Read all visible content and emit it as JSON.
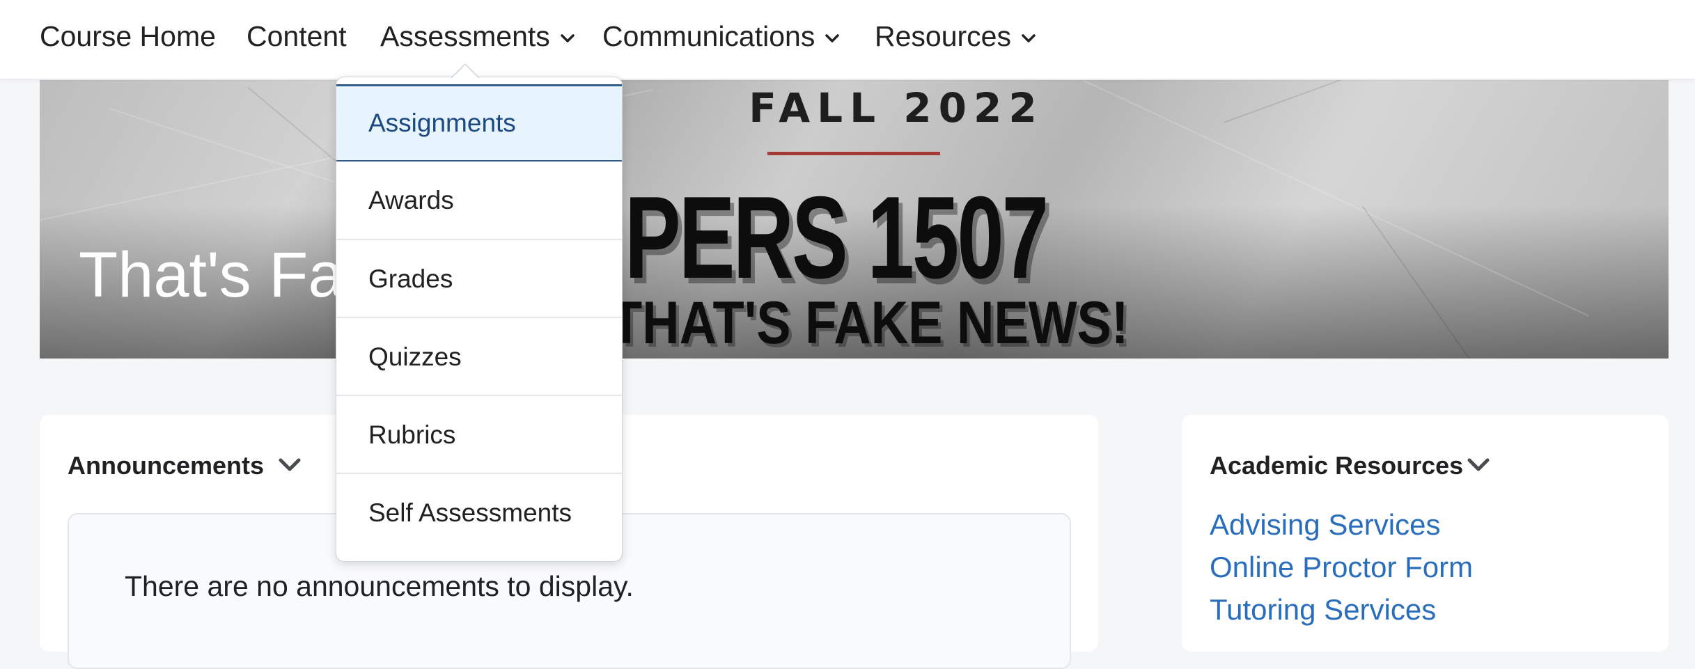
{
  "nav": {
    "items": [
      {
        "label": "Course Home",
        "has_dropdown": false
      },
      {
        "label": "Content",
        "has_dropdown": false
      },
      {
        "label": "Assessments",
        "has_dropdown": true,
        "expanded": true
      },
      {
        "label": "Communications",
        "has_dropdown": true
      },
      {
        "label": "Resources",
        "has_dropdown": true
      }
    ]
  },
  "assessments_menu": {
    "items": [
      {
        "label": "Assignments",
        "highlighted": true
      },
      {
        "label": "Awards"
      },
      {
        "label": "Grades"
      },
      {
        "label": "Quizzes"
      },
      {
        "label": "Rubrics"
      },
      {
        "label": "Self Assessments"
      }
    ]
  },
  "banner": {
    "course_title": "That's Fake News!",
    "image_text": {
      "term": "FALL 2022",
      "course_code": "PERS 1507",
      "tagline": "THAT'S FAKE NEWS!"
    },
    "accent_rule_color": "#a23a3a"
  },
  "announcements": {
    "heading": "Announcements",
    "empty_message": "There are no announcements to display."
  },
  "academic_resources": {
    "heading": "Academic Resources",
    "links": [
      {
        "label": "Advising Services"
      },
      {
        "label": "Online Proctor Form"
      },
      {
        "label": "Tutoring Services"
      }
    ]
  },
  "colors": {
    "link": "#2a6ebb",
    "menu_highlight_bg": "#e8f4fd",
    "menu_highlight_border": "#2f5e8c",
    "page_bg": "#f5f6f8"
  }
}
